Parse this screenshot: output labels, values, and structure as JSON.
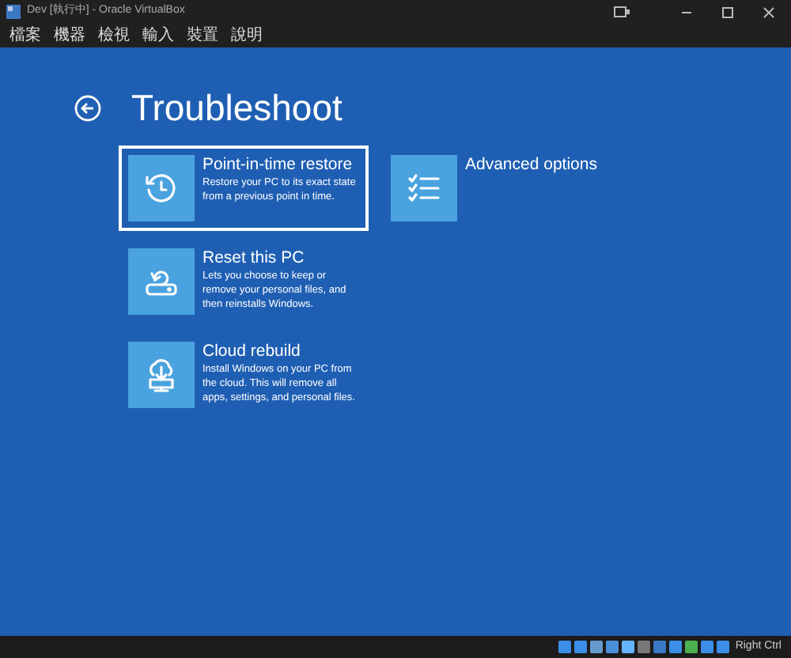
{
  "window": {
    "title": "Dev [執行中] - Oracle VirtualBox"
  },
  "menu": [
    "檔案",
    "機器",
    "檢視",
    "輸入",
    "裝置",
    "說明"
  ],
  "page": {
    "title": "Troubleshoot"
  },
  "options": [
    {
      "kind": "restore",
      "title": "Point-in-time restore",
      "description": "Restore your PC to its exact state from a previous point in time.",
      "selected": true
    },
    {
      "kind": "reset",
      "title": "Reset this PC",
      "description": "Lets you choose to keep or remove your personal files, and then reinstalls Windows.",
      "selected": false
    },
    {
      "kind": "cloud",
      "title": "Cloud rebuild",
      "description": "Install Windows on your PC from the cloud. This will remove all apps, settings, and personal files.",
      "selected": false
    },
    {
      "kind": "advanced",
      "title": "Advanced options",
      "selected": false
    }
  ],
  "status_bar": {
    "host_key": "Right Ctrl"
  }
}
